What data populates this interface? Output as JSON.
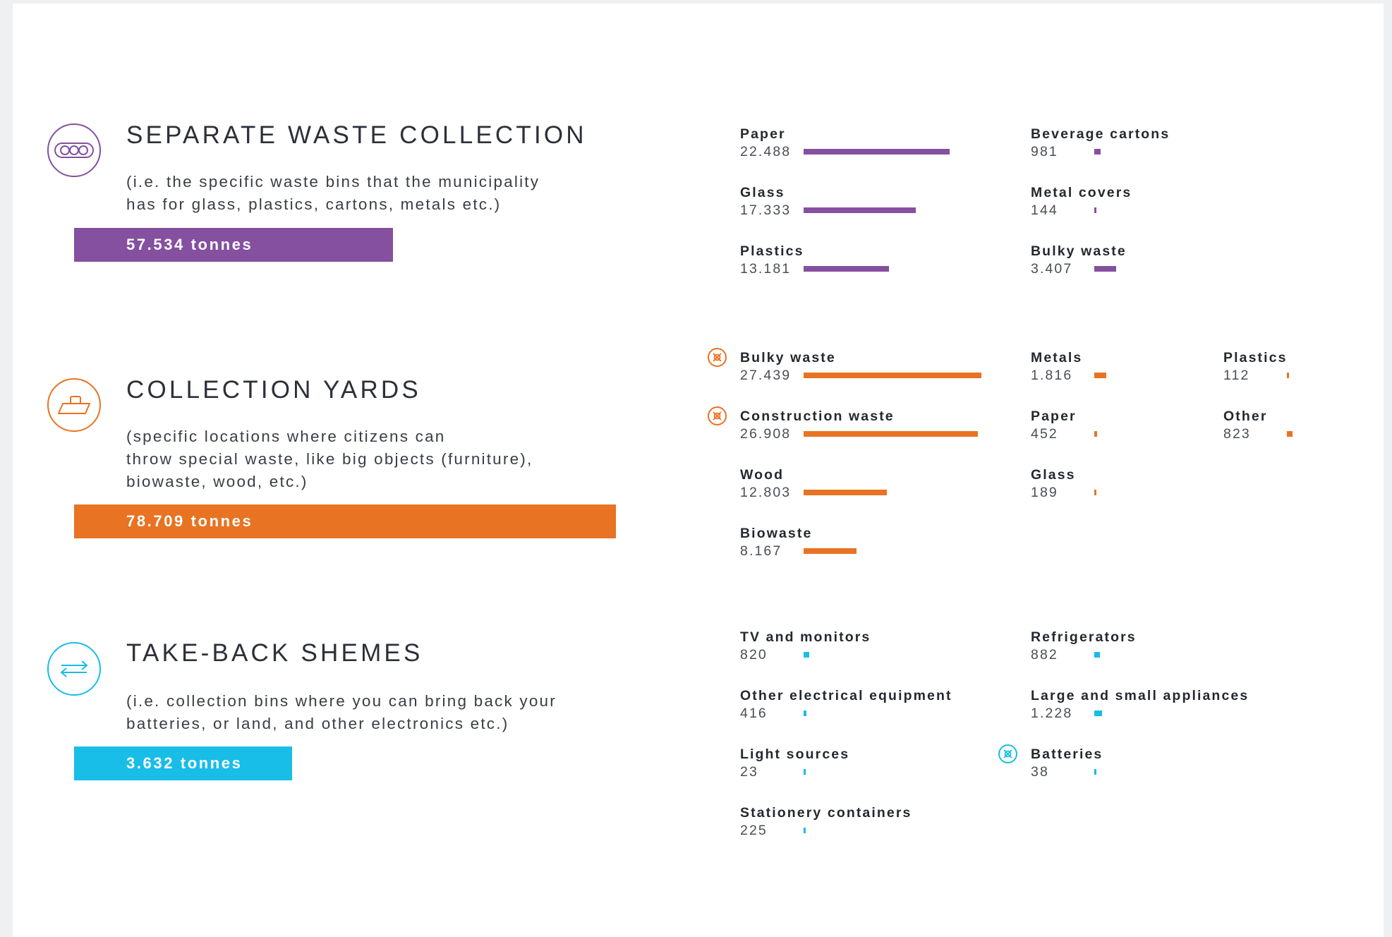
{
  "colors": {
    "separate": "#84509f",
    "yards": "#e87322",
    "takeback": "#18bde8"
  },
  "sections": {
    "separate": {
      "icon": "bins-icon",
      "title": "SEPARATE WASTE COLLECTION",
      "desc": [
        "(i.e. the specific waste bins that the municipality",
        "has for glass, plastics, cartons, metals etc.)"
      ],
      "total_label": "57.534 tonnes",
      "total_value": 57534
    },
    "yards": {
      "icon": "container-icon",
      "title": "COLLECTION YARDS",
      "desc": [
        "(specific locations where citizens can",
        "throw special waste, like big objects (furniture),",
        "biowaste, wood, etc.)"
      ],
      "total_label": "78.709 tonnes",
      "total_value": 78709
    },
    "takeback": {
      "icon": "exchange-arrows-icon",
      "title": "TAKE-BACK SHEMES",
      "desc": [
        "(i.e. collection bins where you can bring back your",
        "batteries, or land, and other electronics etc.)"
      ],
      "total_label": "3.632 tonnes",
      "total_value": 3632
    }
  },
  "chart_data": {
    "type": "bar",
    "unit": "tonnes",
    "series": [
      {
        "group": "separate",
        "items": [
          {
            "name": "Paper",
            "label": "22.488",
            "value": 22488
          },
          {
            "name": "Glass",
            "label": "17.333",
            "value": 17333
          },
          {
            "name": "Plastics",
            "label": "13.181",
            "value": 13181
          },
          {
            "name": "Beverage cartons",
            "label": "981",
            "value": 981
          },
          {
            "name": "Metal covers",
            "label": "144",
            "value": 144
          },
          {
            "name": "Bulky waste",
            "label": "3.407",
            "value": 3407
          }
        ]
      },
      {
        "group": "yards",
        "items": [
          {
            "name": "Bulky waste",
            "label": "27.439",
            "value": 27439,
            "marker": "lifebuoy-icon"
          },
          {
            "name": "Construction waste",
            "label": "26.908",
            "value": 26908,
            "marker": "lifebuoy-icon"
          },
          {
            "name": "Wood",
            "label": "12.803",
            "value": 12803
          },
          {
            "name": "Biowaste",
            "label": "8.167",
            "value": 8167
          },
          {
            "name": "Metals",
            "label": "1.816",
            "value": 1816
          },
          {
            "name": "Paper",
            "label": "452",
            "value": 452
          },
          {
            "name": "Glass",
            "label": "189",
            "value": 189
          },
          {
            "name": "Plastics",
            "label": "112",
            "value": 112
          },
          {
            "name": "Other",
            "label": "823",
            "value": 823
          }
        ]
      },
      {
        "group": "takeback",
        "items": [
          {
            "name": "TV and monitors",
            "label": "820",
            "value": 820
          },
          {
            "name": "Other electrical equipment",
            "label": "416",
            "value": 416
          },
          {
            "name": "Light sources",
            "label": "23",
            "value": 23
          },
          {
            "name": "Stationery containers",
            "label": "225",
            "value": 225
          },
          {
            "name": "Refrigerators",
            "label": "882",
            "value": 882
          },
          {
            "name": "Large and small appliances",
            "label": "1.228",
            "value": 1228
          },
          {
            "name": "Batteries",
            "label": "38",
            "value": 38,
            "marker": "lifebuoy-icon"
          }
        ]
      }
    ]
  }
}
